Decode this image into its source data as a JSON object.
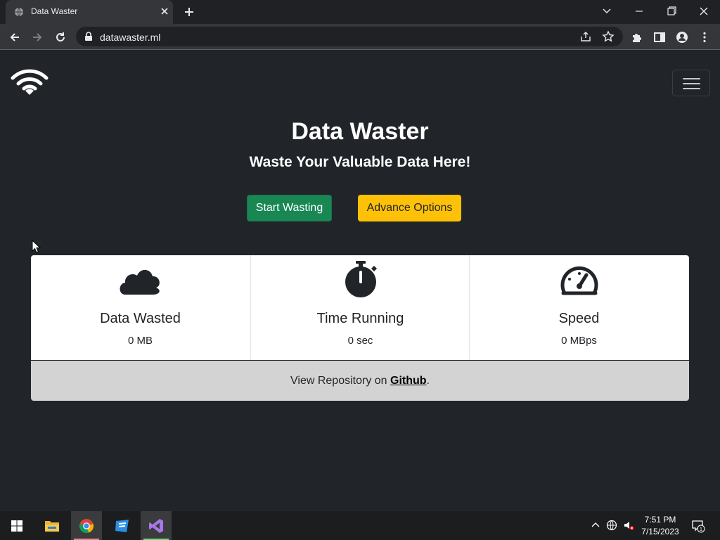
{
  "browser": {
    "tab_title": "Data Waster",
    "url": "datawaster.ml"
  },
  "hero": {
    "title": "Data Waster",
    "subtitle": "Waste Your Valuable Data Here!"
  },
  "buttons": {
    "start": "Start Wasting",
    "advance": "Advance Options"
  },
  "stats": [
    {
      "label": "Data Wasted",
      "value": "0 MB",
      "icon": "cloud-icon"
    },
    {
      "label": "Time Running",
      "value": "0 sec",
      "icon": "stopwatch-icon"
    },
    {
      "label": "Speed",
      "value": "0 MBps",
      "icon": "speedometer-icon"
    }
  ],
  "footer": {
    "prefix": "View Repository on ",
    "link": "Github",
    "suffix": "."
  },
  "taskbar": {
    "time": "7:51 PM",
    "date": "7/15/2023",
    "notification_count": "1"
  },
  "colors": {
    "success": "#198754",
    "warning": "#ffc107",
    "page_bg": "#212529"
  }
}
